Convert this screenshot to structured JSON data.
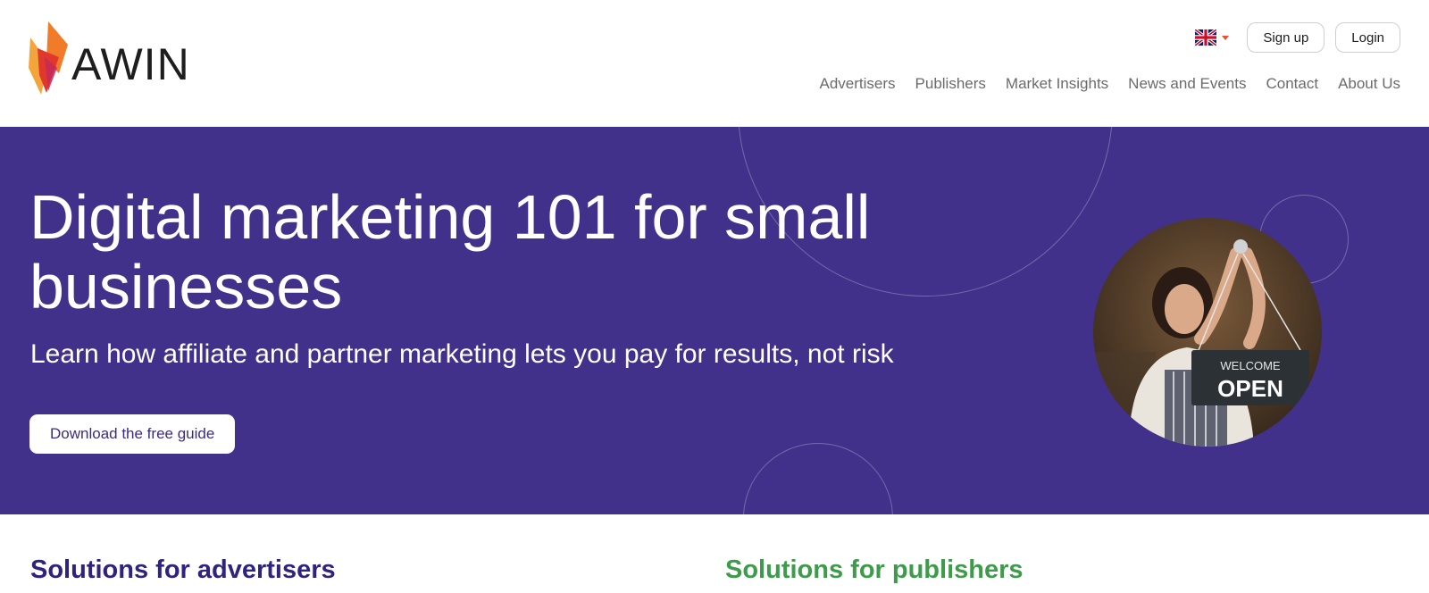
{
  "brand": {
    "name": "AWIN"
  },
  "header": {
    "language_icon": "uk-flag-icon",
    "signup_label": "Sign up",
    "login_label": "Login",
    "nav": [
      "Advertisers",
      "Publishers",
      "Market Insights",
      "News and Events",
      "Contact",
      "About Us"
    ]
  },
  "hero": {
    "title": "Digital marketing 101 for small businesses",
    "subtitle": "Learn how affiliate and partner marketing lets you pay for results, not risk",
    "cta_label": "Download the free guide",
    "image_sign_top": "WELCOME",
    "image_sign_main": "OPEN",
    "background_color": "#41318a"
  },
  "solutions": {
    "advertisers": "Solutions for advertisers",
    "publishers": "Solutions for publishers"
  },
  "colors": {
    "brand_purple": "#41318a",
    "brand_orange": "#e8502e",
    "publisher_green": "#3f9b4c"
  }
}
